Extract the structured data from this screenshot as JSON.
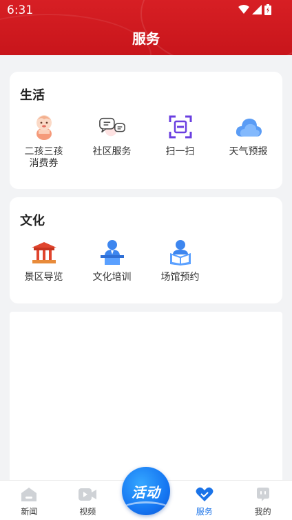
{
  "status_bar": {
    "time": "6:31"
  },
  "header": {
    "title": "服务"
  },
  "sections": [
    {
      "title": "生活",
      "items": [
        {
          "label": "二孩三孩消费券",
          "icon": "baby-icon"
        },
        {
          "label": "社区服务",
          "icon": "chat-bubbles-icon"
        },
        {
          "label": "扫一扫",
          "icon": "scan-icon"
        },
        {
          "label": "天气预报",
          "icon": "cloud-icon"
        }
      ]
    },
    {
      "title": "文化",
      "items": [
        {
          "label": "景区导览",
          "icon": "pavilion-icon"
        },
        {
          "label": "文化培训",
          "icon": "lecturer-icon"
        },
        {
          "label": "场馆预约",
          "icon": "reader-icon"
        }
      ]
    }
  ],
  "bottom_nav": {
    "items": [
      {
        "label": "新闻",
        "icon": "home-icon"
      },
      {
        "label": "视频",
        "icon": "video-icon"
      },
      {
        "label": "服务",
        "icon": "heart-check-icon",
        "active": true
      },
      {
        "label": "我的",
        "icon": "profile-icon"
      }
    ],
    "center_button": "活动"
  },
  "colors": {
    "header_red": "#d71f24",
    "active_blue": "#1a73e8",
    "nav_grey": "#cfd2d6"
  }
}
